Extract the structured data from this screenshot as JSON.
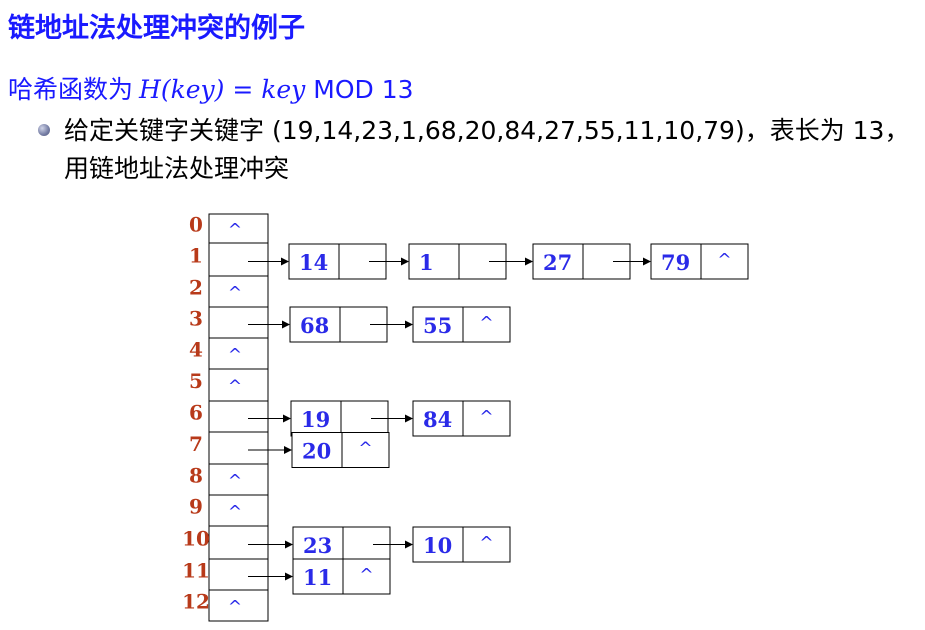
{
  "title": "链地址法处理冲突的例子",
  "hash_function": {
    "label": "哈希函数为",
    "formula_lhs": "H(key) = key",
    "formula_mod": "MOD 13"
  },
  "description": "给定关键字关键字 (19,14,23,1,68,20,84,27,55,11,10,79)，表长为 13，用链地址法处理冲突",
  "null_symbol": "^",
  "colors": {
    "title": "#1a1aff",
    "index": "#b83a1a",
    "key": "#2a2ae8"
  },
  "table": [
    {
      "index": "0",
      "chain": []
    },
    {
      "index": "1",
      "chain": [
        "14",
        "1",
        "27",
        "79"
      ]
    },
    {
      "index": "2",
      "chain": []
    },
    {
      "index": "3",
      "chain": [
        "68",
        "55"
      ]
    },
    {
      "index": "4",
      "chain": []
    },
    {
      "index": "5",
      "chain": []
    },
    {
      "index": "6",
      "chain": [
        "19",
        "84"
      ]
    },
    {
      "index": "7",
      "chain": [
        "20"
      ]
    },
    {
      "index": "8",
      "chain": []
    },
    {
      "index": "9",
      "chain": []
    },
    {
      "index": "10",
      "chain": [
        "23",
        "10"
      ]
    },
    {
      "index": "11",
      "chain": [
        "11"
      ]
    },
    {
      "index": "12",
      "chain": []
    }
  ]
}
